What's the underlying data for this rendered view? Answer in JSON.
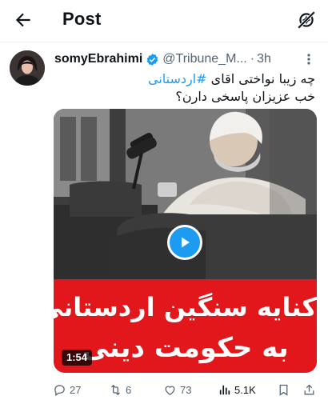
{
  "header": {
    "title": "Post",
    "back_icon": "arrow-left-icon",
    "right_icon": "sparkle-off-icon"
  },
  "tweet": {
    "author_name": "somyEbrahimi",
    "handle": "@Tribune_M...",
    "dot": "·",
    "time": "3h",
    "text_line1_prefix": "چه زیبا نواختی اقای ",
    "hashtag": "#اردستانی",
    "text_line2": "خب عزیزان پاسخی دارن؟",
    "verified_color": "#1d9bf0"
  },
  "media": {
    "banner_line1": "کنایه سنگین اردستانی",
    "banner_line2": "به حکومت دینی",
    "duration": "1:54",
    "banner_color": "#e2171b",
    "play_color": "#1d9bf0"
  },
  "actions": {
    "replies": "27",
    "retweets": "6",
    "likes": "73",
    "views": "5.1K"
  }
}
